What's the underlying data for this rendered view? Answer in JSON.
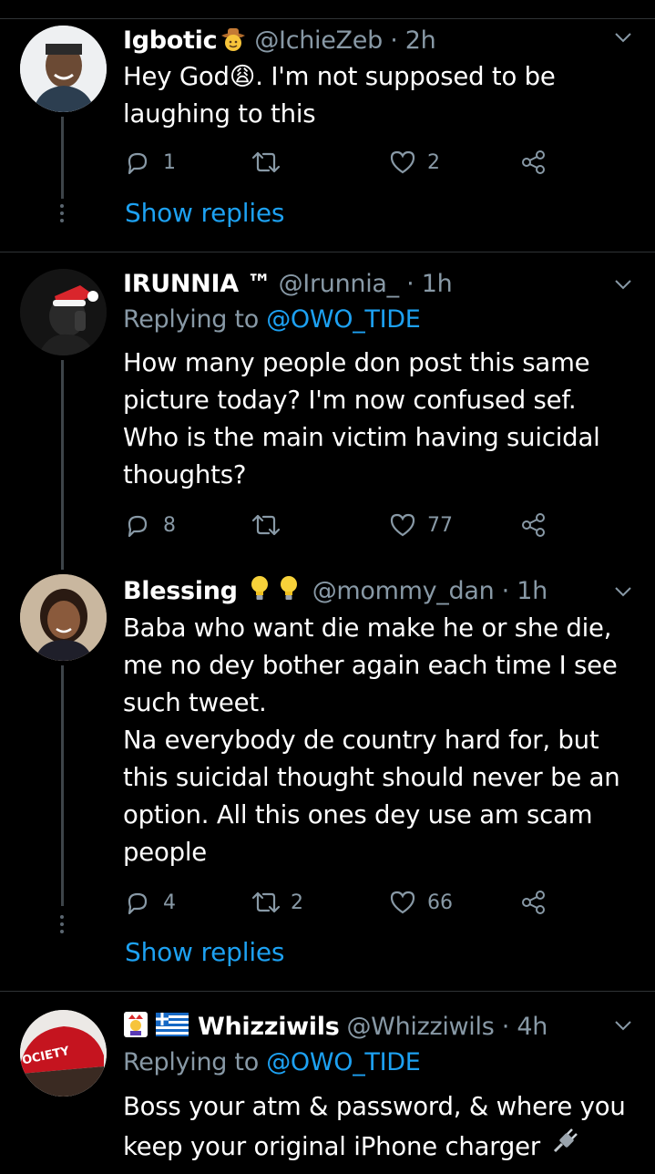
{
  "tweets": [
    {
      "name": "Igbotic",
      "handle": "@IchieZeb · 2h",
      "body": "Hey God😩. I'm not supposed to be laughing to this",
      "replies": "1",
      "retweets": "",
      "likes": "2",
      "show_replies": "Show replies",
      "name_emoji": "cowboy-emoji"
    },
    {
      "name": "IRUNNIA ™",
      "handle": "@Irunnia_ · 1h",
      "replying_prefix": "Replying to",
      "replying_to": "@OWO_TIDE",
      "body": "How many people don post this same picture today? I'm now confused sef. Who is the main victim having suicidal thoughts?",
      "replies": "8",
      "retweets": "",
      "likes": "77"
    },
    {
      "name": "Blessing",
      "handle": "@mommy_dan · 1h",
      "body_lines": [
        "Baba who want die make he or she die,",
        "me no dey bother again each time I see",
        "such tweet.",
        "Na everybody de country hard for, but",
        "this suicidal thought should never be an",
        "option. All this ones dey use am scam",
        "people"
      ],
      "replies": "4",
      "retweets": "2",
      "likes": "66",
      "show_replies": "Show replies",
      "name_emoji": "lightbulb-emoji"
    },
    {
      "name": "Whizziwils",
      "handle": "@Whizziwils · 4h",
      "replying_prefix": "Replying to",
      "replying_to": "@OWO_TIDE",
      "body_lines": [
        "Boss your atm & password, & where you",
        "keep your original iPhone charger"
      ],
      "name_emoji": "joker-flag-emoji",
      "body_emoji": "plug-emoji",
      "avatar_text": "OCIETY"
    }
  ],
  "colors": {
    "background": "#000000",
    "link": "#1da1f2",
    "secondary": "#8899a6",
    "divider": "#2f3336"
  }
}
